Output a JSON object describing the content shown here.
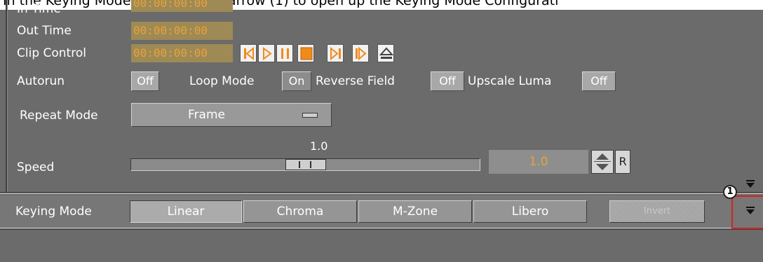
{
  "caption": "In the Keying Mode row, click the arrow (1) to open up the Keying Mode Configurati",
  "fields": {
    "in_time": {
      "label": "In Time",
      "value": "00:00:00:00"
    },
    "out_time": {
      "label": "Out Time",
      "value": "00:00:00:00"
    },
    "clip_control": {
      "label": "Clip Control",
      "value": "00:00:00:00"
    }
  },
  "transport_icons": [
    "skip-to-start-icon",
    "play-icon",
    "pause-icon",
    "stop-icon",
    "step-forward-icon",
    "skip-to-end-icon",
    "eject-icon"
  ],
  "toggles": {
    "autorun": {
      "label": "Autorun",
      "value": "Off"
    },
    "loop_mode": {
      "label": "Loop Mode",
      "value": "On"
    },
    "reverse_field": {
      "label": "Reverse Field",
      "value": "Off"
    },
    "upscale_luma": {
      "label": "Upscale Luma",
      "value": "Off"
    }
  },
  "repeat_mode": {
    "label": "Repeat Mode",
    "value": "Frame"
  },
  "speed": {
    "label": "Speed",
    "slider_value": "1.0",
    "field_value": "1.0",
    "reset_label": "R",
    "slider_fraction": 0.5
  },
  "keying_mode": {
    "label": "Keying Mode",
    "options": [
      "Linear",
      "Chroma",
      "M-Zone",
      "Libero"
    ],
    "selected": "Linear",
    "invert_label": "Invert"
  },
  "callout_number": "1",
  "colors": {
    "timecode": "#e8a23a",
    "highlight_box": "#d62222",
    "panel": "#6b6b6b"
  }
}
